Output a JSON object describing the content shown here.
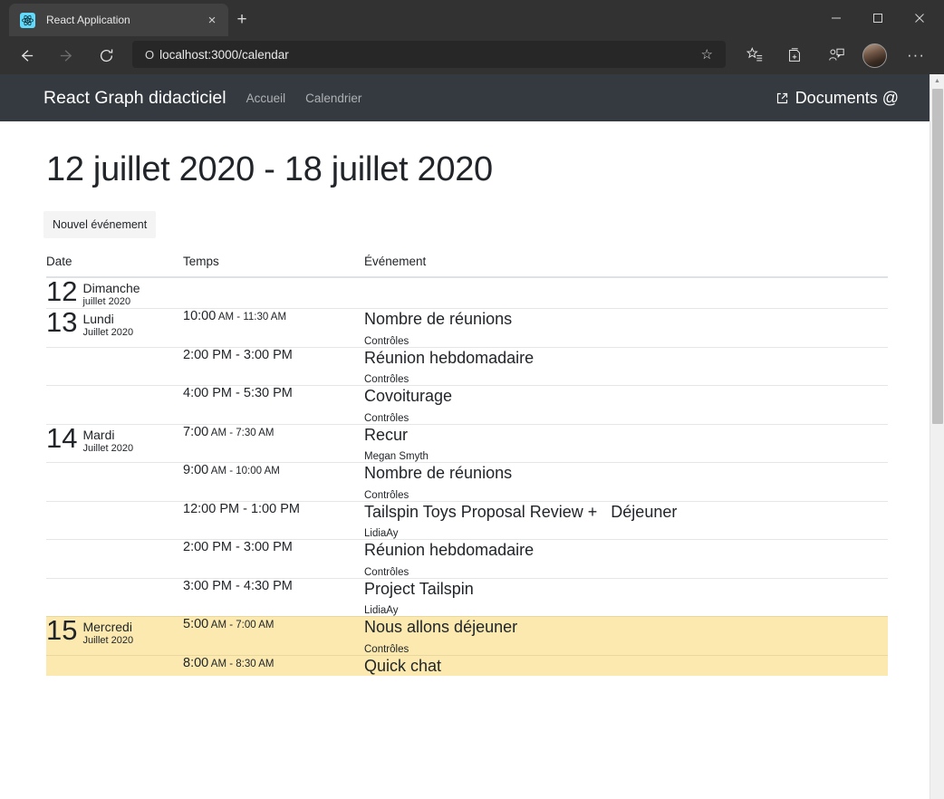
{
  "browser": {
    "tab": {
      "title": "React Application",
      "favicon": "react-logo-icon",
      "close": "×"
    },
    "new_tab": "+",
    "window_controls": {
      "minimize": "—",
      "maximize": "□",
      "close": "✕"
    },
    "toolbar": {
      "back": "←",
      "forward": "→",
      "reload": "↻",
      "url_info": "O",
      "url": "localhost:3000/calendar",
      "favorite": "☆",
      "collections_icon": "collections-icon",
      "favorites_bar_icon": "favorites-list-icon",
      "share_icon": "share-icon",
      "profile_icon": "profile-avatar",
      "more": "···"
    }
  },
  "appbar": {
    "brand": "React Graph didacticiel",
    "links": [
      "Accueil",
      "Calendrier"
    ],
    "right_label": "Documents @"
  },
  "page": {
    "title": "12 juillet 2020 - 18 juillet 2020",
    "new_event_button": "Nouvel événement"
  },
  "table": {
    "headers": {
      "date": "Date",
      "time": "Temps",
      "event": "Événement"
    },
    "rows": [
      {
        "day": "12",
        "dayname": "Dimanche",
        "month": "juillet 2020",
        "time_start": "",
        "time_start_ampm": "",
        "time_end": "",
        "subject": "",
        "organizer": "",
        "highlight": false,
        "first_of_day": true
      },
      {
        "day": "13",
        "dayname": "Lundi",
        "month": "Juillet 2020",
        "time_start": "10:00",
        "time_start_ampm": " AM - 11:30 AM",
        "time_end": "",
        "subject": "Nombre de réunions",
        "organizer": "Contrôles",
        "highlight": false,
        "first_of_day": true
      },
      {
        "day": "",
        "dayname": "",
        "month": "",
        "time_start": "2:00 PM - 3:00 PM",
        "time_start_ampm": "",
        "time_end": "",
        "subject": "Réunion hebdomadaire",
        "organizer": "Contrôles",
        "highlight": false,
        "first_of_day": false
      },
      {
        "day": "",
        "dayname": "",
        "month": "",
        "time_start": "4:00 PM - 5:30 PM",
        "time_start_ampm": "",
        "time_end": "",
        "subject": "Covoiturage",
        "organizer": "Contrôles",
        "highlight": false,
        "first_of_day": false
      },
      {
        "day": "14",
        "dayname": "Mardi",
        "month": "Juillet 2020",
        "time_start": "7:00",
        "time_start_ampm": " AM - 7:30 AM",
        "time_end": "",
        "subject": "Recur",
        "organizer": "Megan Smyth",
        "highlight": false,
        "first_of_day": true
      },
      {
        "day": "",
        "dayname": "",
        "month": "",
        "time_start": "9:00",
        "time_start_ampm": " AM - 10:00 AM",
        "time_end": "",
        "subject": "Nombre de réunions",
        "organizer": "Contrôles",
        "highlight": false,
        "first_of_day": false
      },
      {
        "day": "",
        "dayname": "",
        "month": "",
        "time_start": "12:00 PM - 1:00 PM",
        "time_start_ampm": "",
        "time_end": "",
        "subject": "Tailspin Toys Proposal Review +   Déjeuner",
        "organizer": "LidiaAy",
        "highlight": false,
        "first_of_day": false
      },
      {
        "day": "",
        "dayname": "",
        "month": "",
        "time_start": "2:00 PM - 3:00 PM",
        "time_start_ampm": "",
        "time_end": "",
        "subject": "Réunion hebdomadaire",
        "organizer": "Contrôles",
        "highlight": false,
        "first_of_day": false
      },
      {
        "day": "",
        "dayname": "",
        "month": "",
        "time_start": "3:00 PM - 4:30 PM",
        "time_start_ampm": "",
        "time_end": "",
        "subject": "Project Tailspin",
        "organizer": "LidiaAy",
        "highlight": false,
        "first_of_day": false
      },
      {
        "day": "15",
        "dayname": "Mercredi",
        "month": "Juillet 2020",
        "time_start": "5:00",
        "time_start_ampm": " AM - 7:00 AM",
        "time_end": "",
        "subject": "Nous allons déjeuner",
        "organizer": "Contrôles",
        "highlight": true,
        "first_of_day": true
      },
      {
        "day": "",
        "dayname": "",
        "month": "",
        "time_start": "8:00",
        "time_start_ampm": " AM - 8:30 AM",
        "time_end": "",
        "subject": "Quick chat",
        "organizer": "",
        "highlight": true,
        "first_of_day": false
      }
    ]
  },
  "colors": {
    "chrome": "#323232",
    "appbar": "#343a40",
    "highlight": "#fbe9af",
    "react_blue": "#61dafb"
  }
}
